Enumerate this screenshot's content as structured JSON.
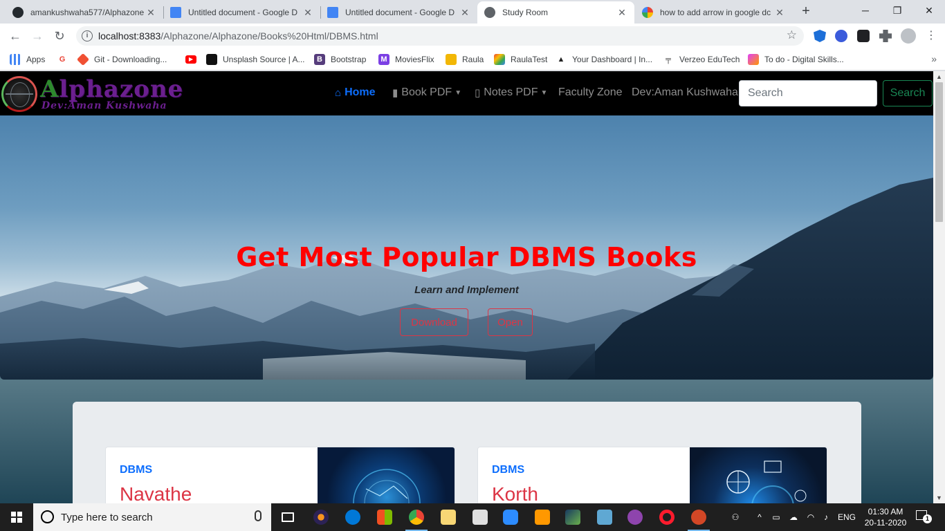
{
  "browser": {
    "tabs": [
      {
        "title": "amankushwaha577/Alphazone",
        "icon": "github-icon",
        "active": false
      },
      {
        "title": "Untitled document - Google D",
        "icon": "google-docs-icon",
        "active": false
      },
      {
        "title": "Untitled document - Google D",
        "icon": "google-docs-icon",
        "active": false
      },
      {
        "title": "Study Room",
        "icon": "globe-icon",
        "active": true
      },
      {
        "title": "how to add arrow in google dc",
        "icon": "google-icon",
        "active": false
      }
    ],
    "new_tab": "+",
    "window_controls": {
      "minimize": "─",
      "maximize": "❐",
      "close": "✕"
    },
    "url_host": "localhost:8383",
    "url_path": "/Alphazone/Alphazone/Books%20Html/DBMS.html",
    "bookmarks": [
      {
        "label": "Apps",
        "icon": "apps-grid-icon",
        "color": "#4285f4"
      },
      {
        "label": "",
        "icon": "google-icon",
        "color": "#ea4335"
      },
      {
        "label": "Git - Downloading...",
        "icon": "git-icon",
        "color": "#f05033"
      },
      {
        "label": "",
        "icon": "youtube-icon",
        "color": "#ff0000"
      },
      {
        "label": "Unsplash Source | A...",
        "icon": "unsplash-icon",
        "color": "#111111"
      },
      {
        "label": "Bootstrap",
        "icon": "bootstrap-icon",
        "color": "#563d7c"
      },
      {
        "label": "MoviesFlix",
        "icon": "moviesflix-icon",
        "color": "#7b3fe4"
      },
      {
        "label": "Raula",
        "icon": "raula-icon",
        "color": "#f2b705"
      },
      {
        "label": "RaulaTest",
        "icon": "raulatest-icon",
        "color": "#34a853"
      },
      {
        "label": "Your Dashboard | In...",
        "icon": "dashboard-icon",
        "color": "#222222"
      },
      {
        "label": "Verzeo EduTech",
        "icon": "verzeo-icon",
        "color": "#333333"
      },
      {
        "label": "To do - Digital Skills...",
        "icon": "todo-icon",
        "color": "#e040fb"
      }
    ],
    "bookmarks_more": "»"
  },
  "site": {
    "brand_name": "Alphazone",
    "brand_sub": "Dev:Aman Kushwaha",
    "nav": {
      "home": "Home",
      "book_pdf": "Book PDF",
      "notes_pdf": "Notes PDF",
      "faculty_zone": "Faculty Zone",
      "dev": "Dev:Aman Kushwaha"
    },
    "search_placeholder": "Search",
    "search_button": "Search",
    "hero": {
      "title": "Get Most Popular DBMS Books",
      "subtitle": "Learn and Implement",
      "download_button": "Download",
      "open_button": "Open"
    },
    "books": [
      {
        "category": "DBMS",
        "title": "Navathe"
      },
      {
        "category": "DBMS",
        "title": "Korth"
      }
    ],
    "colors": {
      "accent": "#0d6efd",
      "danger": "#dc3545",
      "success": "#198754",
      "hero_title": "#ff0000"
    }
  },
  "taskbar": {
    "search_placeholder": "Type here to search",
    "language": "ENG",
    "time": "01:30 AM",
    "date": "20-11-2020",
    "notification_count": "1"
  }
}
